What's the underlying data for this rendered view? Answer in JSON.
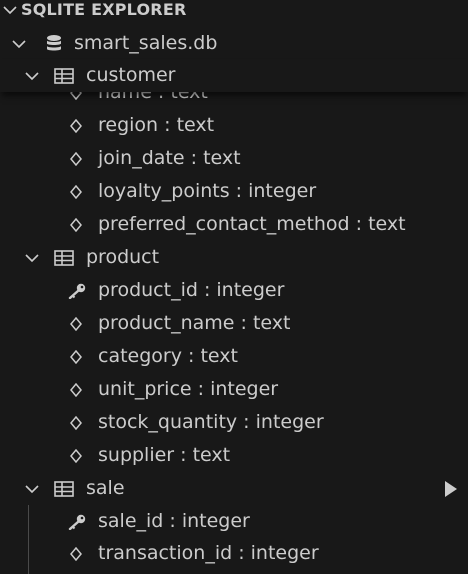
{
  "explorer": {
    "section_title": "SQLITE EXPLORER",
    "database": {
      "name": "smart_sales.db",
      "icon": "database-icon"
    },
    "tables": [
      {
        "name": "customer",
        "columns": [
          {
            "name": "name",
            "type": "text",
            "key": false
          },
          {
            "name": "region",
            "type": "text",
            "key": false
          },
          {
            "name": "join_date",
            "type": "text",
            "key": false
          },
          {
            "name": "loyalty_points",
            "type": "integer",
            "key": false
          },
          {
            "name": "preferred_contact_method",
            "type": "text",
            "key": false
          }
        ]
      },
      {
        "name": "product",
        "columns": [
          {
            "name": "product_id",
            "type": "integer",
            "key": true
          },
          {
            "name": "product_name",
            "type": "text",
            "key": false
          },
          {
            "name": "category",
            "type": "text",
            "key": false
          },
          {
            "name": "unit_price",
            "type": "integer",
            "key": false
          },
          {
            "name": "stock_quantity",
            "type": "integer",
            "key": false
          },
          {
            "name": "supplier",
            "type": "text",
            "key": false
          }
        ]
      },
      {
        "name": "sale",
        "columns": [
          {
            "name": "sale_id",
            "type": "integer",
            "key": true
          },
          {
            "name": "transaction_id",
            "type": "integer",
            "key": false
          }
        ]
      }
    ],
    "separator": " : "
  },
  "colors": {
    "background": "#181818",
    "text": "#cccccc",
    "indent_guide": "#4a4a4a"
  }
}
